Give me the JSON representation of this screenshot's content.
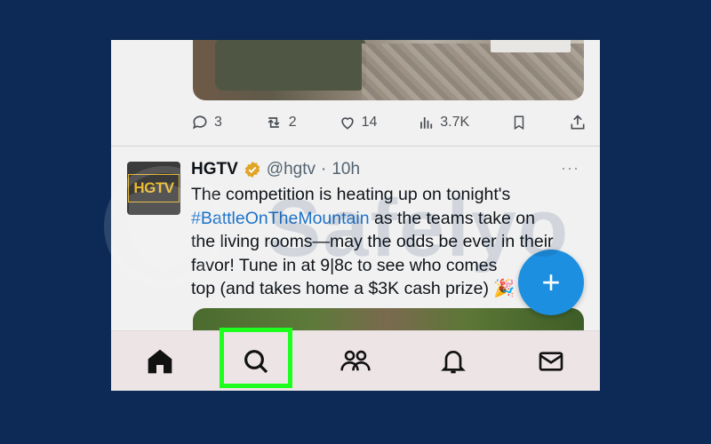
{
  "previous_tweet": {
    "replies": "3",
    "reposts": "2",
    "likes": "14",
    "views": "3.7K"
  },
  "tweet": {
    "avatar_logo_text": "HGTV",
    "name": "HGTV",
    "handle": "@hgtv",
    "separator": "·",
    "time": "10h",
    "more": "···",
    "text_lines": [
      "The competition is heating up on tonight's",
      "as the teams take on",
      "the living rooms—may the odds be ever in their",
      "favor! Tune in at 9|8c to see who comes",
      "top (and takes home a $3K cash prize) 🎉"
    ],
    "hashtag": "#BattleOnTheMountain"
  },
  "fab": {
    "label": "+",
    "color": "#1d8fe0"
  },
  "bottom_nav": {
    "items": [
      "home-icon",
      "search-icon",
      "communities-icon",
      "notifications-icon",
      "messages-icon"
    ],
    "highlight_color": "#1dff1d"
  },
  "watermark": {
    "text": "Safelyo"
  },
  "colors": {
    "background": "#0c2a55",
    "link": "#1d73c9",
    "verified_badge": "#e0a526"
  }
}
